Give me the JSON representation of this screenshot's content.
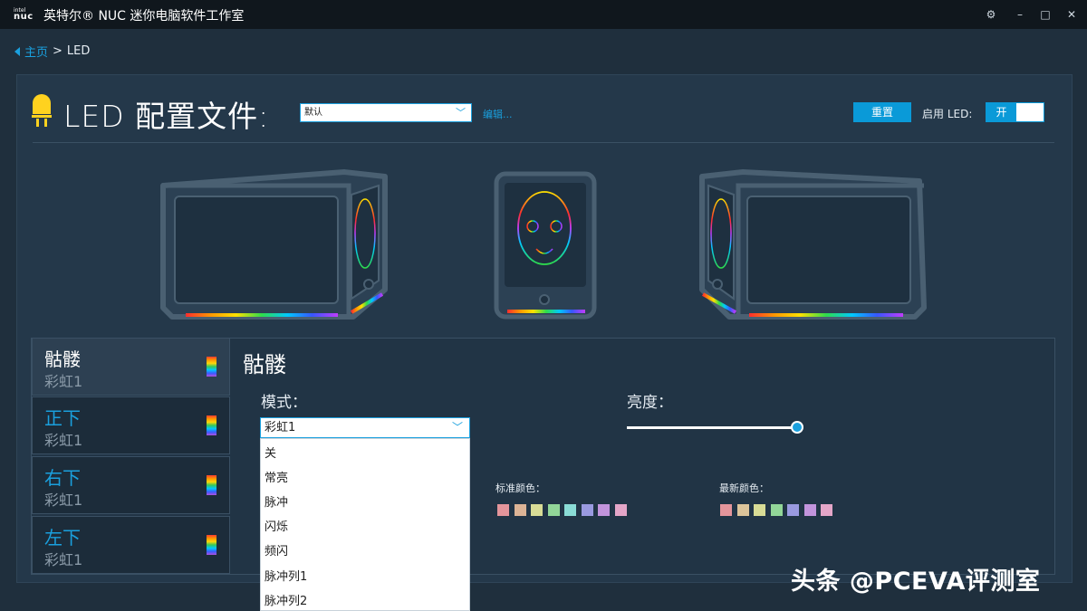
{
  "window": {
    "logo_line1": "intel",
    "logo_line2": "nuc",
    "title": "英特尔® NUC 迷你电脑软件工作室",
    "icons": [
      "gear-icon",
      "minimize-icon",
      "maximize-icon",
      "close-icon"
    ]
  },
  "breadcrumb": {
    "home": "主页",
    "separator": ">",
    "current": "LED"
  },
  "header": {
    "title": "LED 配置文件:",
    "profile_value": "默认",
    "edit_link": "编辑...",
    "reset_label": "重置",
    "enable_label": "启用 LED:",
    "toggle_on_label": "开"
  },
  "zones": [
    {
      "name": "骷髅",
      "mode": "彩虹1",
      "active": true
    },
    {
      "name": "正下",
      "mode": "彩虹1",
      "active": false
    },
    {
      "name": "右下",
      "mode": "彩虹1",
      "active": false
    },
    {
      "name": "左下",
      "mode": "彩虹1",
      "active": false
    }
  ],
  "detail": {
    "title": "骷髅",
    "mode_label": "模式：",
    "mode_value": "彩虹1",
    "mode_options": [
      "关",
      "常亮",
      "脉冲",
      "闪烁",
      "频闪",
      "脉冲列1",
      "脉冲列2"
    ],
    "brightness_label": "亮度：",
    "brightness_level": 1.0,
    "standard_colors_label": "标准颜色：",
    "recent_colors_label": "最新颜色：",
    "standard_colors": [
      "#e4959b",
      "#dcb496",
      "#d8dc96",
      "#92d698",
      "#8adcd6",
      "#9a9ae0",
      "#c294dc",
      "#e4a6c8"
    ],
    "recent_colors": [
      "#e4959b",
      "#dcc49a",
      "#d8dc96",
      "#92d698",
      "#9a9ae0",
      "#c294dc",
      "#e4a6c8"
    ]
  },
  "watermark": "头条 @PCEVA评测室"
}
